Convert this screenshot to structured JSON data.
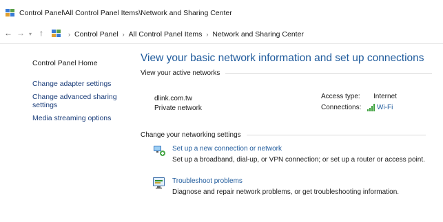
{
  "window": {
    "title": "Control Panel\\All Control Panel Items\\Network and Sharing Center"
  },
  "address": {
    "crumbs": [
      "Control Panel",
      "All Control Panel Items",
      "Network and Sharing Center"
    ]
  },
  "sidebar": {
    "items": [
      {
        "label": "Control Panel Home"
      },
      {
        "label": "Change adapter settings"
      },
      {
        "label": "Change advanced sharing"
      },
      {
        "label": "settings"
      },
      {
        "label": "Media streaming options"
      }
    ]
  },
  "main": {
    "title": "View your basic network information and set up connections",
    "active_networks": {
      "heading": "View your active networks",
      "network_name": "dlink.com.tw",
      "network_type": "Private network",
      "access_type_label": "Access type:",
      "access_type_value": "Internet",
      "connections_label": "Connections:",
      "connections_value": "Wi-Fi"
    },
    "settings": {
      "heading": "Change your networking settings",
      "tasks": [
        {
          "link": "Set up a new connection or network",
          "description": "Set up a broadband, dial-up, or VPN connection; or set up a router or access point.",
          "icon": "network-setup-icon"
        },
        {
          "link": "Troubleshoot problems",
          "description": "Diagnose and repair network problems, or get troubleshooting information.",
          "icon": "troubleshoot-icon"
        }
      ]
    }
  },
  "colors": {
    "link": "#1e5a9c",
    "title": "#1e5a9c",
    "sidebar_link": "#1a3d7a"
  }
}
